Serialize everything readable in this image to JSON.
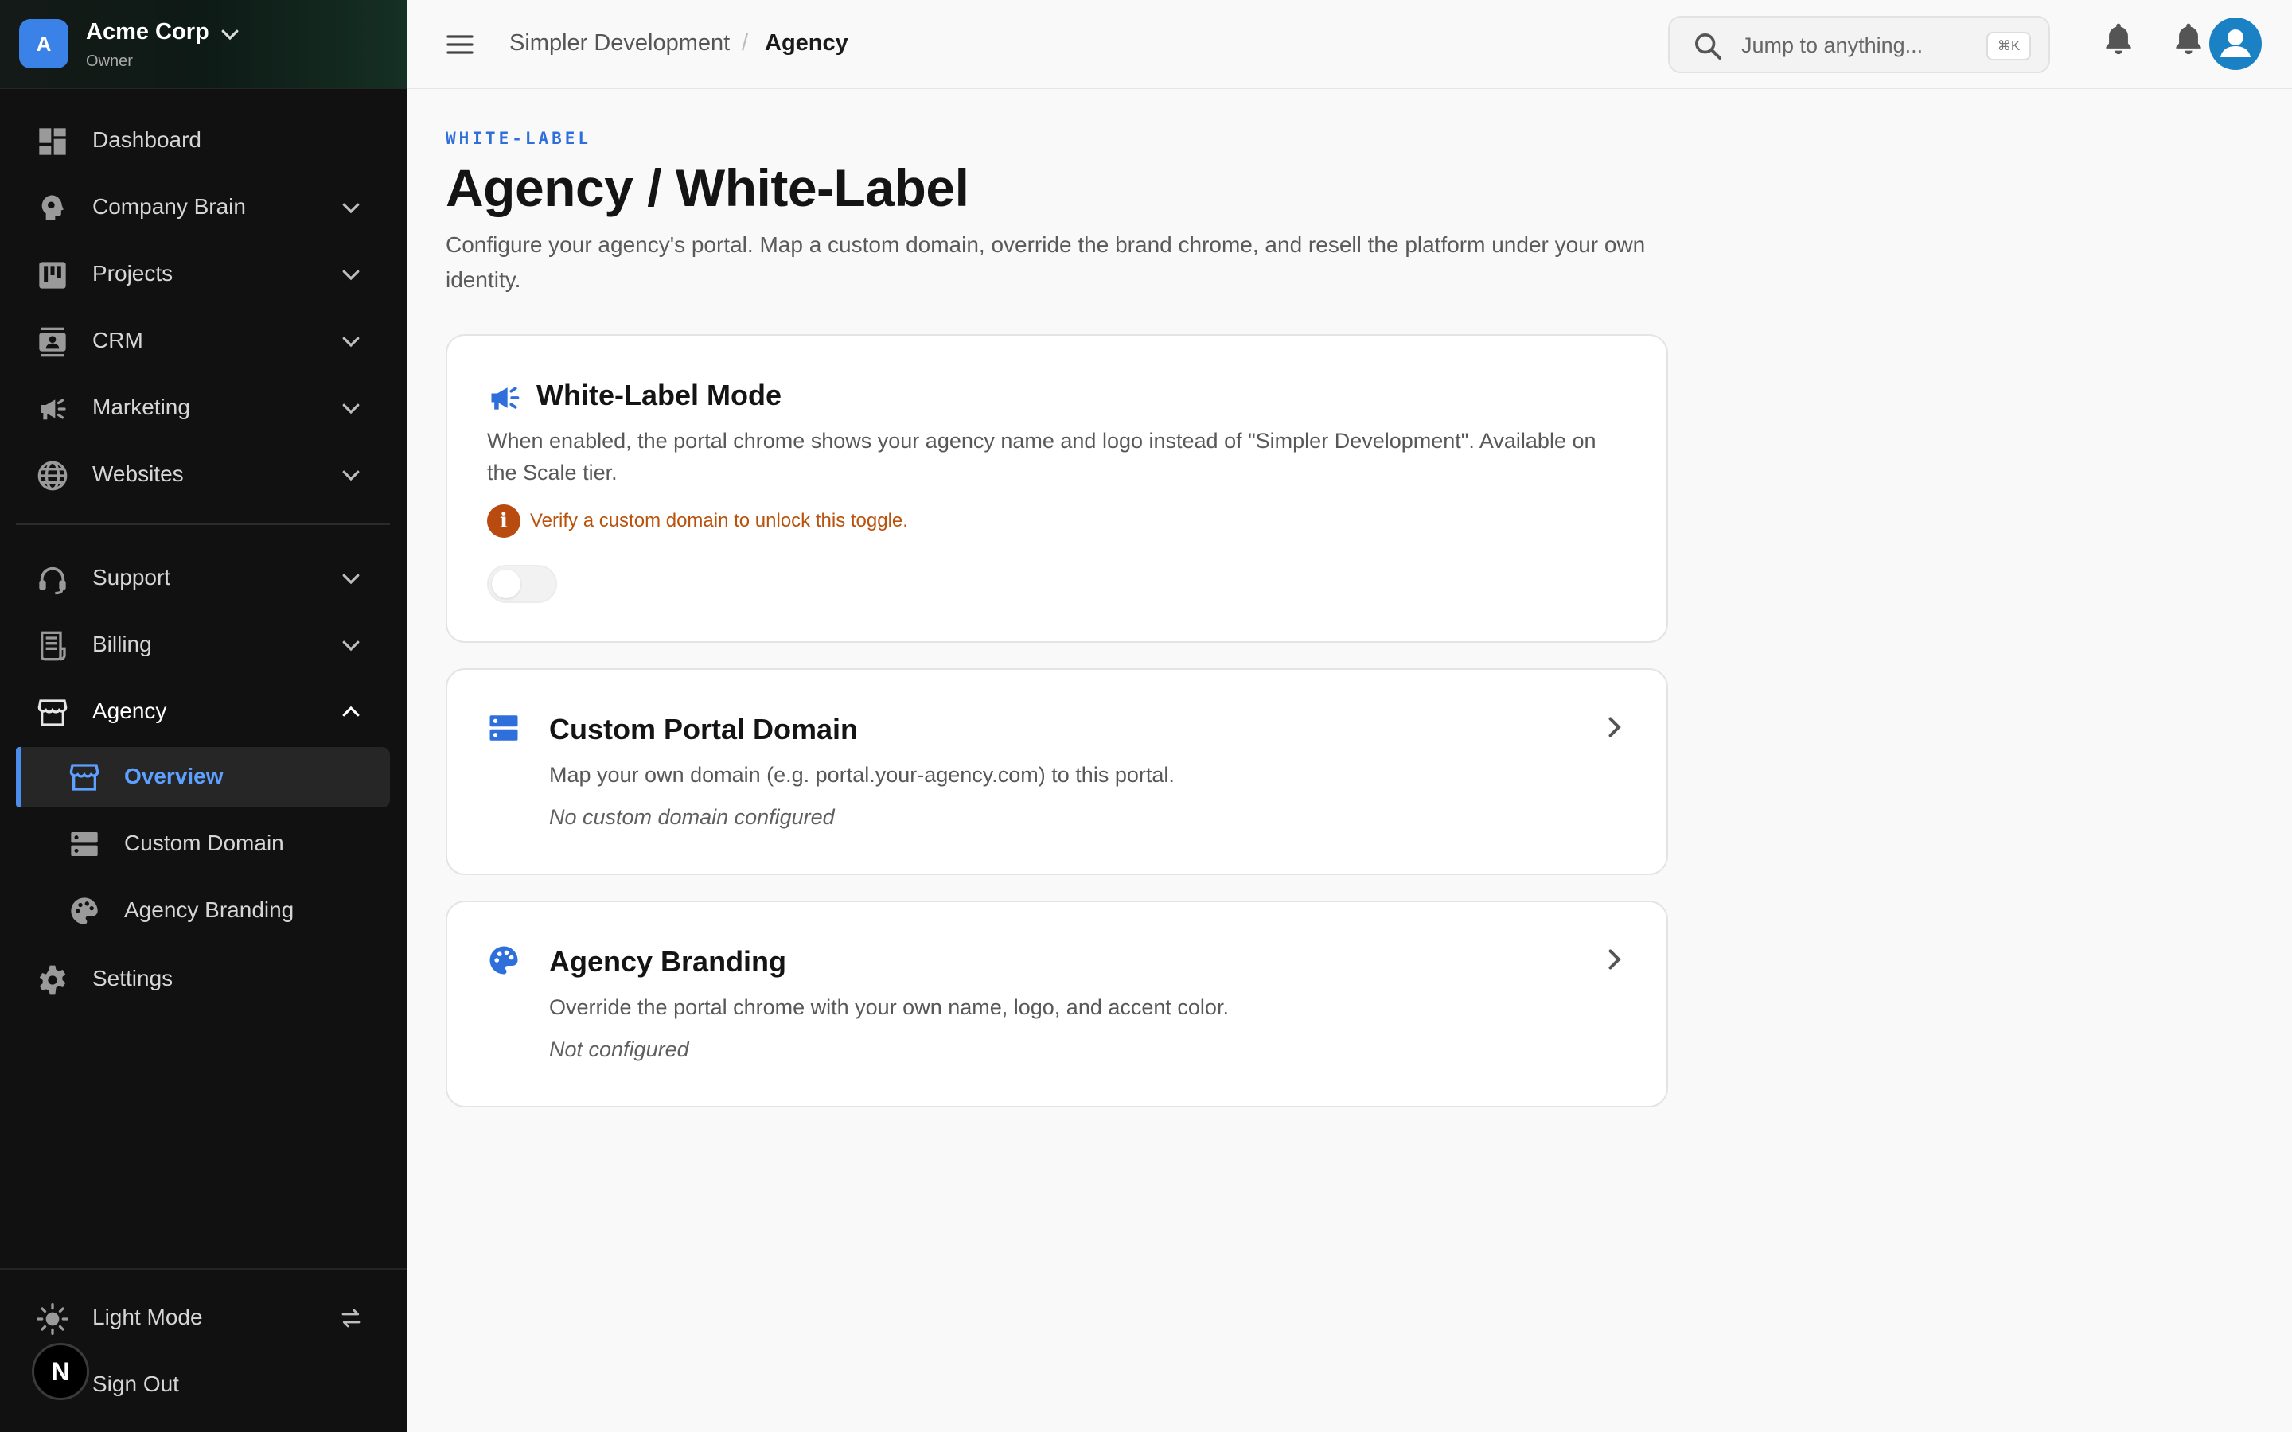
{
  "org": {
    "initial": "A",
    "name": "Acme Corp",
    "role": "Owner"
  },
  "sidebar": {
    "items": [
      {
        "label": "Dashboard",
        "icon": "dashboard-icon"
      },
      {
        "label": "Company Brain",
        "icon": "brain-icon"
      },
      {
        "label": "Projects",
        "icon": "kanban-icon"
      },
      {
        "label": "CRM",
        "icon": "contacts-icon"
      },
      {
        "label": "Marketing",
        "icon": "megaphone-icon"
      },
      {
        "label": "Websites",
        "icon": "globe-icon"
      },
      {
        "label": "Support",
        "icon": "headset-icon"
      },
      {
        "label": "Billing",
        "icon": "receipt-icon"
      },
      {
        "label": "Agency",
        "icon": "storefront-icon"
      },
      {
        "label": "Settings",
        "icon": "gear-icon"
      }
    ],
    "agency_sub": [
      {
        "label": "Overview",
        "icon": "storefront-icon",
        "active": true
      },
      {
        "label": "Custom Domain",
        "icon": "server-icon"
      },
      {
        "label": "Agency Branding",
        "icon": "palette-icon"
      }
    ],
    "theme_label": "Light Mode",
    "signout_label": "Sign Out",
    "n_badge": "N"
  },
  "topbar": {
    "breadcrumb": [
      "Simpler Development",
      "Agency"
    ],
    "breadcrumb_sep": "/",
    "search_placeholder": "Jump to anything...",
    "search_shortcut": "⌘K"
  },
  "page": {
    "eyebrow": "WHITE-LABEL",
    "title": "Agency / White-Label",
    "description": "Configure your agency's portal. Map a custom domain, override the brand chrome, and resell the platform under your own identity."
  },
  "cards": {
    "white_label": {
      "title": "White-Label Mode",
      "description": "When enabled, the portal chrome shows your agency name and logo instead of \"Simpler Development\". Available on the Scale tier.",
      "warning": "Verify a custom domain to unlock this toggle.",
      "toggle_on": false
    },
    "domain": {
      "title": "Custom Portal Domain",
      "description": "Map your own domain (e.g. portal.your-agency.com) to this portal.",
      "status": "No custom domain configured"
    },
    "branding": {
      "title": "Agency Branding",
      "description": "Override the portal chrome with your own name, logo, and accent color.",
      "status": "Not configured"
    }
  },
  "colors": {
    "accent": "#2f6fdc",
    "sidebar_bg": "#111111",
    "warning": "#b9520c",
    "active_nav": "#5da0ff"
  }
}
